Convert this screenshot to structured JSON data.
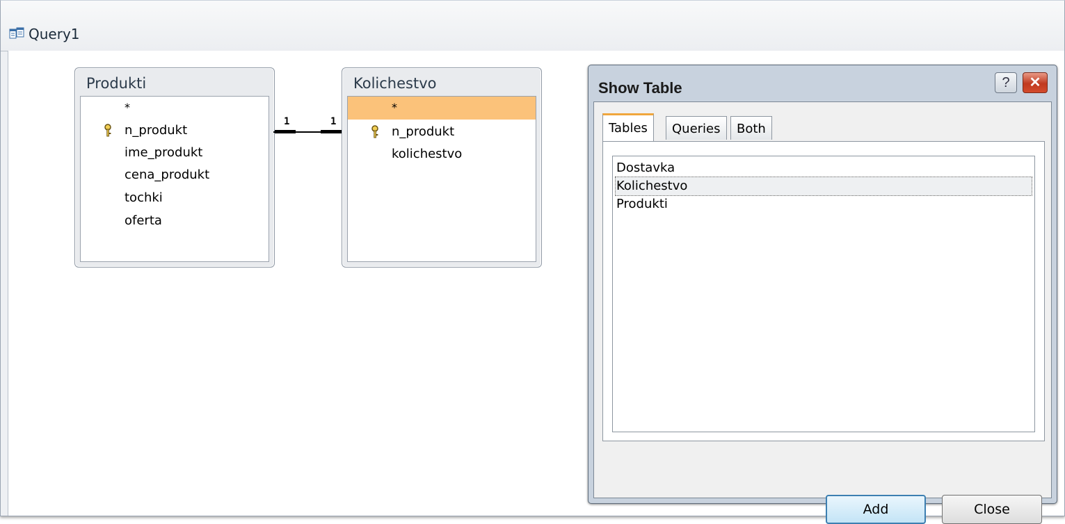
{
  "window": {
    "title": "Query1",
    "icon": "query-icon"
  },
  "tables": [
    {
      "name": "Produkti",
      "fields": [
        {
          "label": "*",
          "key": false,
          "selected": false
        },
        {
          "label": "n_produkt",
          "key": true,
          "selected": false
        },
        {
          "label": "ime_produkt",
          "key": false,
          "selected": false
        },
        {
          "label": "cena_produkt",
          "key": false,
          "selected": false
        },
        {
          "label": "tochki",
          "key": false,
          "selected": false
        },
        {
          "label": "oferta",
          "key": false,
          "selected": false
        }
      ]
    },
    {
      "name": "Kolichestvo",
      "fields": [
        {
          "label": "*",
          "key": false,
          "selected": true
        },
        {
          "label": "n_produkt",
          "key": true,
          "selected": false
        },
        {
          "label": "kolichestvo",
          "key": false,
          "selected": false
        }
      ]
    }
  ],
  "relationship": {
    "left_label": "1",
    "right_label": "1"
  },
  "dialog": {
    "title": "Show Table",
    "help_label": "?",
    "close_glyph": "✕",
    "tabs": [
      {
        "label": "Tables",
        "active": true
      },
      {
        "label": "Queries",
        "active": false
      },
      {
        "label": "Both",
        "active": false
      }
    ],
    "items": [
      "Dostavka",
      "Kolichestvo",
      "Produkti"
    ],
    "focused_item": "Kolichestvo",
    "add_label": "Add",
    "close_label": "Close"
  },
  "colors": {
    "selected_field": "#fbc27a",
    "active_tab_accent": "#f0a63c",
    "close_button": "#c0391f"
  }
}
